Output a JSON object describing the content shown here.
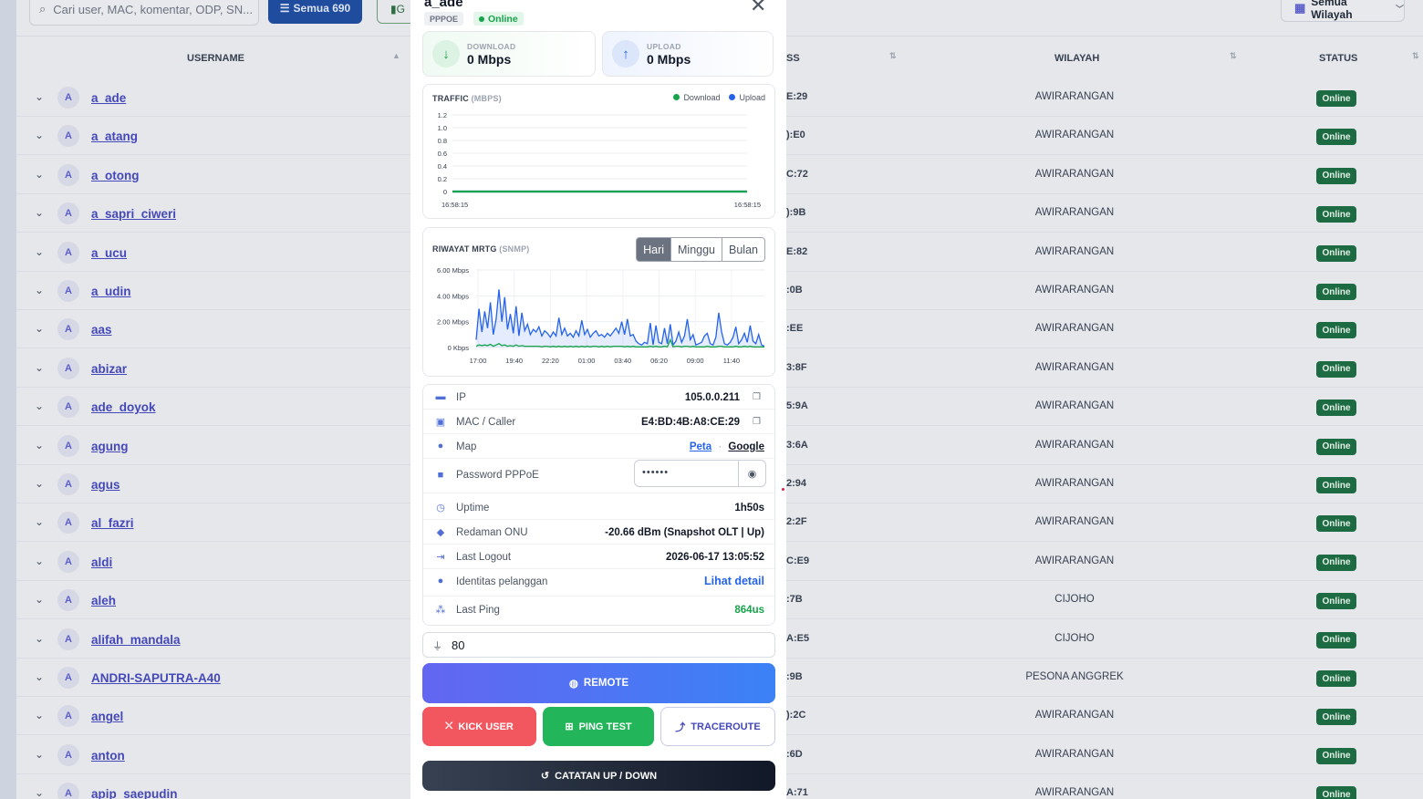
{
  "toolbar": {
    "search_placeholder": "Cari user, MAC, komentar, ODP, SN...",
    "filter_all_label": "Semua 690",
    "signal_label": "G",
    "region_label": "Semua Wilayah"
  },
  "table": {
    "headers": {
      "username": "USERNAME",
      "mac": "SS",
      "wilayah": "WILAYAH",
      "status": "STATUS"
    },
    "rows": [
      {
        "initial": "A",
        "username": "a_ade",
        "mac": "E:29",
        "wilayah": "AWIRARANGAN",
        "status": "Online"
      },
      {
        "initial": "A",
        "username": "a_atang",
        "mac": "):E0",
        "wilayah": "AWIRARANGAN",
        "status": "Online"
      },
      {
        "initial": "A",
        "username": "a_otong",
        "mac": "C:72",
        "wilayah": "AWIRARANGAN",
        "status": "Online"
      },
      {
        "initial": "A",
        "username": "a_sapri_ciweri",
        "mac": "):9B",
        "wilayah": "AWIRARANGAN",
        "status": "Online"
      },
      {
        "initial": "A",
        "username": "a_ucu",
        "mac": "E:82",
        "wilayah": "AWIRARANGAN",
        "status": "Online"
      },
      {
        "initial": "A",
        "username": "a_udin",
        "mac": ":0B",
        "wilayah": "AWIRARANGAN",
        "status": "Online"
      },
      {
        "initial": "A",
        "username": "aas",
        "mac": ":EE",
        "wilayah": "AWIRARANGAN",
        "status": "Online"
      },
      {
        "initial": "A",
        "username": "abizar",
        "mac": "3:8F",
        "wilayah": "AWIRARANGAN",
        "status": "Online"
      },
      {
        "initial": "A",
        "username": "ade_doyok",
        "mac": "5:9A",
        "wilayah": "AWIRARANGAN",
        "status": "Online"
      },
      {
        "initial": "A",
        "username": "agung",
        "mac": "3:6A",
        "wilayah": "AWIRARANGAN",
        "status": "Online"
      },
      {
        "initial": "A",
        "username": "agus",
        "mac": "2:94",
        "wilayah": "AWIRARANGAN",
        "status": "Online"
      },
      {
        "initial": "A",
        "username": "al_fazri",
        "mac": "2:2F",
        "wilayah": "AWIRARANGAN",
        "status": "Online"
      },
      {
        "initial": "A",
        "username": "aldi",
        "mac": "C:E9",
        "wilayah": "AWIRARANGAN",
        "status": "Online"
      },
      {
        "initial": "A",
        "username": "aleh",
        "mac": ":7B",
        "wilayah": "CIJOHO",
        "status": "Online"
      },
      {
        "initial": "A",
        "username": "alifah_mandala",
        "mac": "A:E5",
        "wilayah": "CIJOHO",
        "status": "Online"
      },
      {
        "initial": "A",
        "username": "ANDRI-SAPUTRA-A40",
        "mac": ":9B",
        "wilayah": "PESONA ANGGREK",
        "status": "Online"
      },
      {
        "initial": "A",
        "username": "angel",
        "mac": "):2C",
        "wilayah": "AWIRARANGAN",
        "status": "Online"
      },
      {
        "initial": "A",
        "username": "anton",
        "mac": ":6D",
        "wilayah": "AWIRARANGAN",
        "status": "Online"
      },
      {
        "initial": "A",
        "username": "apip_saepudin",
        "mac": "A:71",
        "wilayah": "AWIRARANGAN",
        "status": "Online"
      }
    ]
  },
  "modal": {
    "title": "a_ade",
    "type_badge": "PPPOE",
    "status_badge": "Online",
    "download": {
      "label": "DOWNLOAD",
      "value": "0 Mbps"
    },
    "upload": {
      "label": "UPLOAD",
      "value": "0 Mbps"
    },
    "traffic": {
      "title": "TRAFFIC",
      "unit": "(MBPS)",
      "legend_download": "Download",
      "legend_upload": "Upload"
    },
    "mrtg": {
      "title": "RIWAYAT MRTG",
      "source": "(SNMP)",
      "tabs": [
        "Hari",
        "Minggu",
        "Bulan"
      ],
      "active_tab": "Hari"
    },
    "info": {
      "ip_label": "IP",
      "ip_value": "105.0.0.211",
      "mac_label": "MAC / Caller",
      "mac_value": "E4:BD:4B:A8:CE:29",
      "map_label": "Map",
      "map_link1": "Peta",
      "map_sep": "·",
      "map_link2": "Google",
      "password_label": "Password PPPoE",
      "password_value": "••••••",
      "uptime_label": "Uptime",
      "uptime_value": "1h50s",
      "redaman_label": "Redaman ONU",
      "redaman_value": "-20.66 dBm (Snapshot OLT | Up)",
      "logout_label": "Last Logout",
      "logout_value": "2026-06-17 13:05:52",
      "identitas_label": "Identitas pelanggan",
      "identitas_link": "Lihat detail",
      "ping_label": "Last Ping",
      "ping_value": "864us"
    },
    "port_value": "80",
    "buttons": {
      "remote": "REMOTE",
      "kick": "KICK USER",
      "ping": "PING TEST",
      "traceroute": "TRACEROUTE",
      "updown": "CATATAN UP / DOWN"
    }
  },
  "chart_data": [
    {
      "type": "line",
      "title": "TRAFFIC (MBPS)",
      "x": [
        "16:58:15",
        "16:58:15"
      ],
      "ylim": [
        0,
        1.2
      ],
      "yticks": [
        "1.2",
        "1.0",
        "0.8",
        "0.6",
        "0.4",
        "0.2",
        "0"
      ],
      "xticks": [
        "16:58:15",
        "16:58:15"
      ],
      "series": [
        {
          "name": "Download",
          "color": "#16a34a",
          "values": [
            0,
            0
          ]
        },
        {
          "name": "Upload",
          "color": "#2563eb",
          "values": [
            0,
            0
          ]
        }
      ],
      "grid": true,
      "legend": "top-right"
    },
    {
      "type": "area",
      "title": "RIWAYAT MRTG (SNMP)",
      "ylim": [
        0,
        6
      ],
      "yticks": [
        "6.00 Mbps",
        "4.00 Mbps",
        "2.00 Mbps",
        "0 Kbps"
      ],
      "xticks": [
        "17:00",
        "19:40",
        "22:20",
        "01:00",
        "03:40",
        "06:20",
        "09:00",
        "11:40"
      ],
      "series": [
        {
          "color": "#2563eb",
          "values": [
            0.6,
            3.0,
            1.2,
            2.8,
            1.5,
            3.5,
            1.0,
            2.2,
            4.5,
            2.0,
            3.9,
            1.4,
            2.6,
            1.1,
            3.2,
            0.9,
            2.7,
            1.3,
            1.8,
            1.0,
            1.4,
            1.2,
            1.6,
            0.9,
            1.3,
            1.1,
            0.8,
            1.2,
            0.9,
            2.3,
            1.0,
            1.5,
            0.9,
            1.1,
            0.8,
            1.3,
            0.9,
            2.1,
            1.0,
            1.4,
            0.8,
            1.1,
            1.3,
            0.9,
            1.0,
            0.8,
            1.1,
            0.9,
            1.2,
            1.5,
            1.1,
            2.0,
            1.0,
            2.2,
            0.9,
            1.0,
            0.5,
            0.3,
            0.2,
            0.4,
            0.3,
            1.9,
            0.2,
            1.7,
            0.4,
            0.3,
            1.5,
            0.3,
            1.8,
            0.2,
            0.5,
            1.2,
            0.4,
            0.9,
            2.2,
            0.6,
            1.0,
            0.2,
            0.3,
            0.4,
            0.9,
            1.1,
            0.3,
            0.2,
            0.8,
            2.7,
            1.2,
            0.3,
            0.2,
            0.4,
            0.8,
            1.6,
            0.3,
            0.6,
            1.1,
            0.4,
            1.7,
            0.5,
            0.3,
            1.0,
            0.2,
            0.1
          ]
        },
        {
          "color": "#16a34a",
          "values": [
            0.1,
            0.2,
            0.15,
            0.2,
            0.15,
            0.25,
            0.1,
            0.2,
            0.3,
            0.15,
            0.2,
            0.1,
            0.15,
            0.1,
            0.2,
            0.1,
            0.15,
            0.1,
            0.1,
            0.1,
            0.1,
            0.1,
            0.1,
            0.05,
            0.1,
            0.1,
            0.05,
            0.1,
            0.05,
            0.1,
            0.05,
            0.1,
            0.05,
            0.1,
            0.05,
            0.1,
            0.05,
            0.1,
            0.05,
            0.1,
            0.05,
            0.1,
            0.1,
            0.05,
            0.1,
            0.05,
            0.1,
            0.05,
            0.1,
            0.1,
            0.1,
            0.1,
            0.05,
            0.1,
            0.05,
            0.1,
            0.05,
            0.05,
            0.05,
            0.05,
            0.05,
            0.1,
            0.05,
            0.1,
            0.05,
            0.05,
            0.1,
            0.05,
            0.6,
            0.05,
            0.1,
            0.1,
            0.05,
            0.1,
            0.1,
            0.05,
            0.1,
            0.05,
            0.05,
            0.05,
            0.05,
            0.1,
            0.05,
            0.05,
            0.05,
            0.1,
            0.1,
            0.05,
            0.05,
            0.05,
            0.05,
            0.1,
            0.05,
            0.05,
            0.1,
            0.05,
            0.1,
            0.05,
            0.05,
            0.05,
            0.05,
            0.05
          ]
        }
      ],
      "grid": true
    }
  ]
}
